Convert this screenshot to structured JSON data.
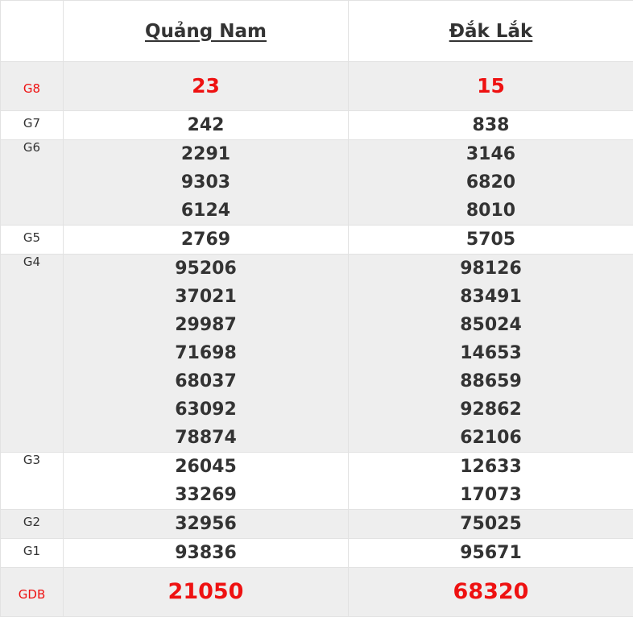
{
  "provinces": [
    "Quảng Nam",
    "Đắk Lắk"
  ],
  "rows": [
    {
      "label": "G8",
      "p1": [
        "23"
      ],
      "p2": [
        "15"
      ]
    },
    {
      "label": "G7",
      "p1": [
        "242"
      ],
      "p2": [
        "838"
      ]
    },
    {
      "label": "G6",
      "p1": [
        "2291",
        "9303",
        "6124"
      ],
      "p2": [
        "3146",
        "6820",
        "8010"
      ]
    },
    {
      "label": "G5",
      "p1": [
        "2769"
      ],
      "p2": [
        "5705"
      ]
    },
    {
      "label": "G4",
      "p1": [
        "95206",
        "37021",
        "29987",
        "71698",
        "68037",
        "63092",
        "78874"
      ],
      "p2": [
        "98126",
        "83491",
        "85024",
        "14653",
        "88659",
        "92862",
        "62106"
      ]
    },
    {
      "label": "G3",
      "p1": [
        "26045",
        "33269"
      ],
      "p2": [
        "12633",
        "17073"
      ]
    },
    {
      "label": "G2",
      "p1": [
        "32956"
      ],
      "p2": [
        "75025"
      ]
    },
    {
      "label": "G1",
      "p1": [
        "93836"
      ],
      "p2": [
        "95671"
      ]
    },
    {
      "label": "GDB",
      "p1": [
        "21050"
      ],
      "p2": [
        "68320"
      ]
    }
  ],
  "colors": {
    "highlight": "#ee1111",
    "text": "#333333",
    "shade": "#eeeeee"
  }
}
